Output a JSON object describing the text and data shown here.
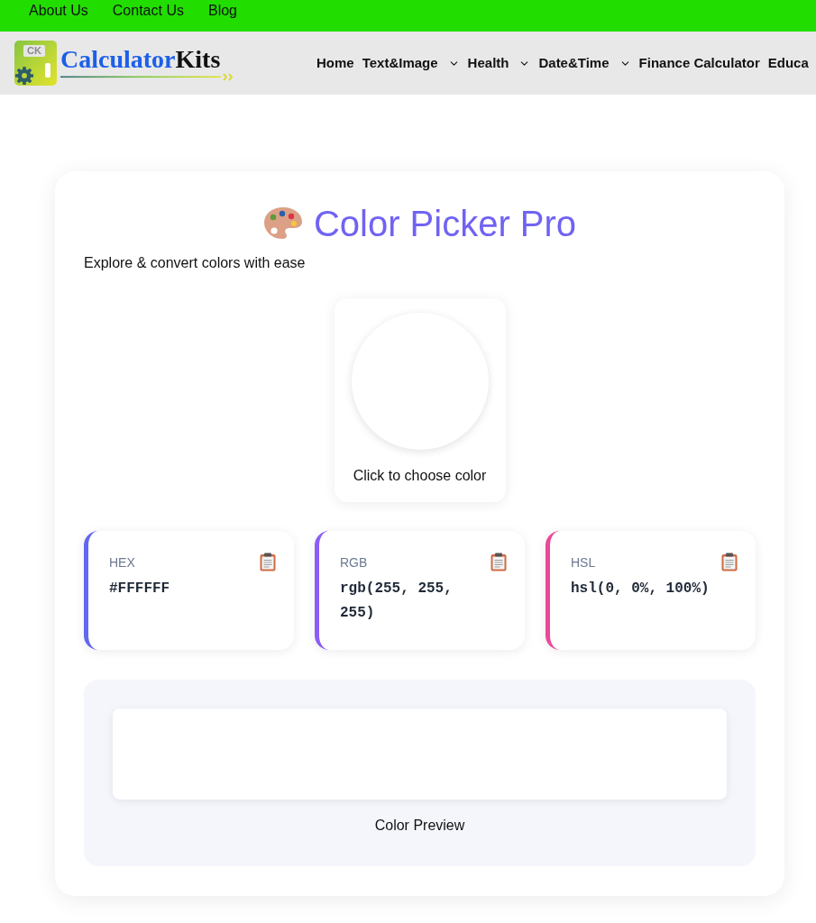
{
  "top_links": [
    "About Us",
    "Contact Us",
    "Blog"
  ],
  "logo": {
    "badge": "CK",
    "name": [
      "Calculator",
      "Kits"
    ]
  },
  "nav": [
    {
      "label": "Home",
      "has_menu": false
    },
    {
      "label": "Text&Image",
      "has_menu": true
    },
    {
      "label": "Health",
      "has_menu": true
    },
    {
      "label": "Date&Time",
      "has_menu": true
    },
    {
      "label": "Finance Calculator",
      "has_menu": false
    },
    {
      "label": "Educa",
      "has_menu": false
    }
  ],
  "tool": {
    "title": "Color Picker Pro",
    "subtitle": "Explore & convert colors with ease"
  },
  "picker": {
    "color": "#ffffff",
    "label": "Click to choose color"
  },
  "formats": [
    {
      "label": "HEX",
      "value": "#FFFFFF",
      "color": "#6366f1"
    },
    {
      "label": "RGB",
      "value": "rgb(255, 255, 255)",
      "color": "#8b5cf6"
    },
    {
      "label": "HSL",
      "value": "hsl(0, 0%, 100%)",
      "color": "#ec4899"
    }
  ],
  "preview": {
    "label": "Color Preview"
  }
}
